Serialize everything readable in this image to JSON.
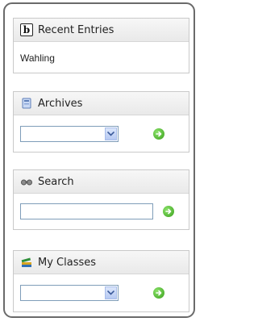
{
  "recent_entries": {
    "title": "Recent Entries",
    "icon": "b",
    "items": [
      "Wahling"
    ]
  },
  "archives": {
    "title": "Archives",
    "selected": ""
  },
  "search": {
    "title": "Search",
    "value": ""
  },
  "my_classes": {
    "title": "My Classes",
    "selected": ""
  },
  "colors": {
    "border": "#6a6a6a",
    "go_green": "#3a9f1c",
    "input_border": "#7f9db9"
  }
}
